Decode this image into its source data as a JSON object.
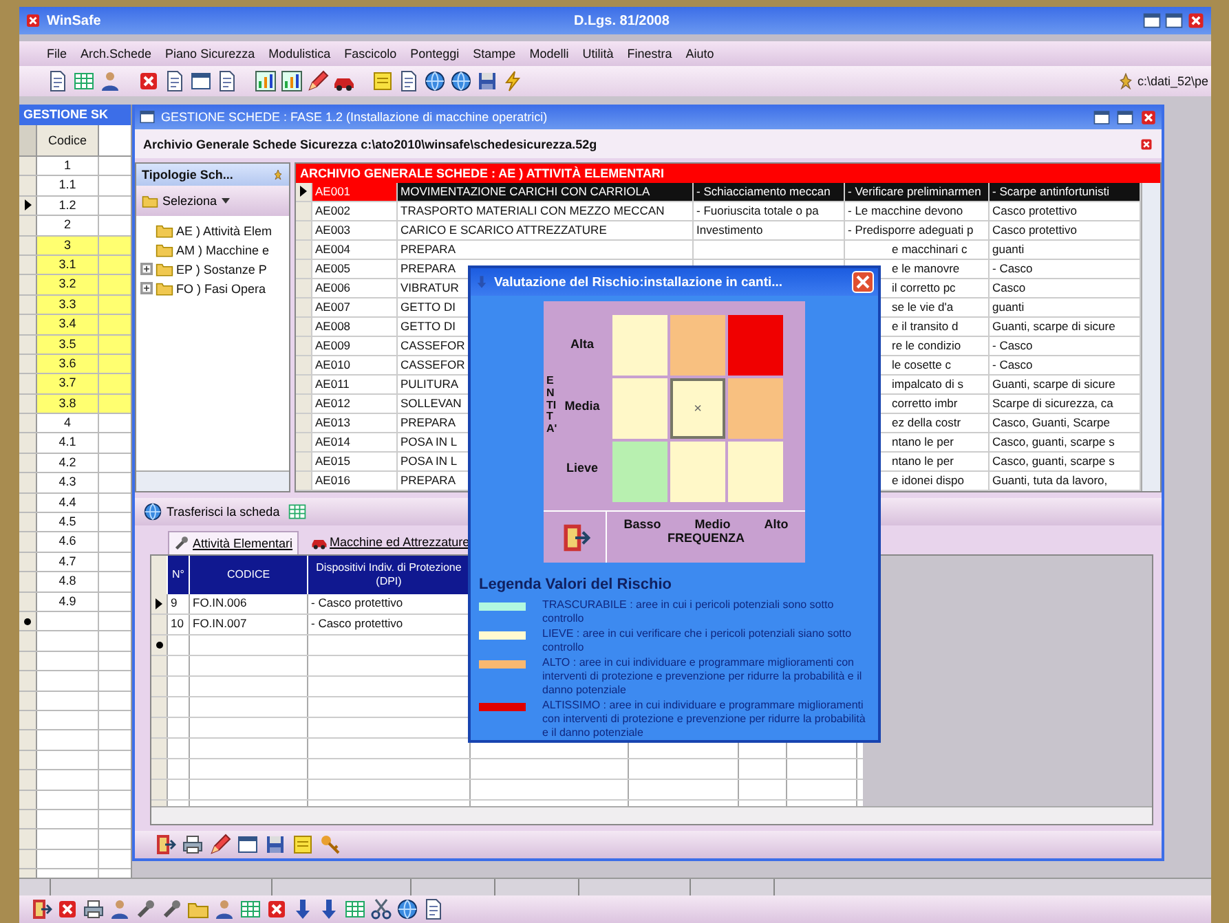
{
  "app": {
    "title": "WinSafe",
    "subtitle": "D.Lgs. 81/2008",
    "path": "c:\\dati_52\\pe"
  },
  "menu": [
    "File",
    "Arch.Schede",
    "Piano Sicurezza",
    "Modulistica",
    "Fascicolo",
    "Ponteggi",
    "Stampe",
    "Modelli",
    "Utilità",
    "Finestra",
    "Aiuto"
  ],
  "side_panel": {
    "title": "GESTIONE SK",
    "column": "Codice",
    "rows": [
      {
        "code": "1",
        "highlighted": false,
        "selected": false
      },
      {
        "code": "1.1",
        "highlighted": false,
        "selected": false
      },
      {
        "code": "1.2",
        "highlighted": false,
        "selected": true
      },
      {
        "code": "2",
        "highlighted": false,
        "selected": false
      },
      {
        "code": "3",
        "highlighted": true,
        "selected": false
      },
      {
        "code": "3.1",
        "highlighted": true,
        "selected": false
      },
      {
        "code": "3.2",
        "highlighted": true,
        "selected": false
      },
      {
        "code": "3.3",
        "highlighted": true,
        "selected": false
      },
      {
        "code": "3.4",
        "highlighted": true,
        "selected": false
      },
      {
        "code": "3.5",
        "highlighted": true,
        "selected": false
      },
      {
        "code": "3.6",
        "highlighted": true,
        "selected": false
      },
      {
        "code": "3.7",
        "highlighted": true,
        "selected": false
      },
      {
        "code": "3.8",
        "highlighted": true,
        "selected": false
      },
      {
        "code": "4",
        "highlighted": false,
        "selected": false
      },
      {
        "code": "4.1",
        "highlighted": false,
        "selected": false
      },
      {
        "code": "4.2",
        "highlighted": false,
        "selected": false
      },
      {
        "code": "4.3",
        "highlighted": false,
        "selected": false
      },
      {
        "code": "4.4",
        "highlighted": false,
        "selected": false
      },
      {
        "code": "4.5",
        "highlighted": false,
        "selected": false
      },
      {
        "code": "4.6",
        "highlighted": false,
        "selected": false
      },
      {
        "code": "4.7",
        "highlighted": false,
        "selected": false
      },
      {
        "code": "4.8",
        "highlighted": false,
        "selected": false
      },
      {
        "code": "4.9",
        "highlighted": false,
        "selected": false
      }
    ]
  },
  "child_window": {
    "title": "GESTIONE SCHEDE : FASE 1.2 (Installazione di macchine operatrici)",
    "header": "Archivio Generale Schede Sicurezza c:\\ato2010\\winsafe\\schedesicurezza.52g",
    "tree_panel": {
      "title": "Tipologie Sch...",
      "button": "Seleziona",
      "items": [
        {
          "label": "AE ) Attività Elem",
          "expandable": false
        },
        {
          "label": "AM ) Macchine e",
          "expandable": false
        },
        {
          "label": "EP ) Sostanze P",
          "expandable": true
        },
        {
          "label": "FO ) Fasi Opera",
          "expandable": true
        }
      ]
    },
    "table": {
      "title": "ARCHIVIO GENERALE SCHEDE : AE ) ATTIVITÀ ELEMENTARI",
      "rows": [
        {
          "code": "AE001",
          "column_2": "MOVIMENTAZIONE CARICHI CON CARRIOLA",
          "column_3": "- Schiacciamento meccan",
          "column_4": "- Verificare preliminarmen",
          "column_5": "- Scarpe antinfortunisti",
          "selected": true
        },
        {
          "code": "AE002",
          "column_2": "TRASPORTO MATERIALI CON MEZZO MECCAN",
          "column_3": "- Fuoriuscita totale o pa",
          "column_4": "- Le macchine devono",
          "column_5": "Casco protettivo",
          "selected": false
        },
        {
          "code": "AE003",
          "column_2": "CARICO E SCARICO ATTREZZATURE",
          "column_3": "Investimento",
          "column_4": "- Predisporre adeguati p",
          "column_5": "Casco protettivo",
          "selected": false
        },
        {
          "code": "AE004",
          "column_2": "PREPARA",
          "column_4": "e macchinari c",
          "column_5": "guanti",
          "selected": false
        },
        {
          "code": "AE005",
          "column_2": "PREPARA",
          "column_4": "e le manovre",
          "column_5": "- Casco",
          "selected": false
        },
        {
          "code": "AE006",
          "column_2": "VIBRATUR",
          "column_4": "il corretto pc",
          "column_5": "Casco",
          "selected": false
        },
        {
          "code": "AE007",
          "column_2": "GETTO DI",
          "column_4": "se le vie d'a",
          "column_5": "guanti",
          "selected": false
        },
        {
          "code": "AE008",
          "column_2": "GETTO DI",
          "column_4": "e il transito d",
          "column_5": "Guanti, scarpe di sicure",
          "selected": false
        },
        {
          "code": "AE009",
          "column_2": "CASSEFOR",
          "column_4": "re le condizio",
          "column_5": "- Casco",
          "selected": false
        },
        {
          "code": "AE010",
          "column_2": "CASSEFOR",
          "column_4": "le cosette c",
          "column_5": "- Casco",
          "selected": false
        },
        {
          "code": "AE011",
          "column_2": "PULITURA",
          "column_4": "impalcato di s",
          "column_5": "Guanti, scarpe di sicure",
          "selected": false
        },
        {
          "code": "AE012",
          "column_2": "SOLLEVAN",
          "column_4": "corretto imbr",
          "column_5": "Scarpe di sicurezza, ca",
          "selected": false
        },
        {
          "code": "AE013",
          "column_2": "PREPARA",
          "column_4": "ez della costr",
          "column_5": "Casco, Guanti, Scarpe",
          "selected": false
        },
        {
          "code": "AE014",
          "column_2": "POSA IN L",
          "column_4": "ntano le per",
          "column_5": "Casco, guanti, scarpe s",
          "selected": false
        },
        {
          "code": "AE015",
          "column_2": "POSA IN L",
          "column_4": "ntano le per",
          "column_5": "Casco, guanti, scarpe s",
          "selected": false
        },
        {
          "code": "AE016",
          "column_2": "PREPARA",
          "column_4": "e idonei dispo",
          "column_5": "Guanti, tuta da lavoro,",
          "selected": false
        }
      ]
    },
    "transfer_button": "Trasferisci la scheda",
    "tabs": [
      {
        "label": "Attività Elementari",
        "selected": true
      },
      {
        "label": "Macchine ed Attrezzature",
        "selected": false
      }
    ],
    "lower_table": {
      "columns": [
        "N°",
        "CODICE",
        "Dispositivi Indiv. di Protezione (DPI)"
      ],
      "rows": [
        {
          "number": "9",
          "code": "FO.IN.006",
          "dpi": "- Casco protettivo",
          "selected": true
        },
        {
          "number": "10",
          "code": "FO.IN.007",
          "dpi": "- Casco protettivo",
          "selected": false
        }
      ]
    }
  },
  "dialog": {
    "title": "Valutazione del Rischio:installazione in canti...",
    "y_axis": "ENTITA'",
    "marker": "×",
    "rows": [
      {
        "label": "Alta",
        "cells": [
          {
            "color": "#fff8c8",
            "marked": false
          },
          {
            "color": "#f8c080",
            "marked": false
          },
          {
            "color": "#f00000",
            "marked": false
          }
        ]
      },
      {
        "label": "Media",
        "cells": [
          {
            "color": "#fff8c8",
            "marked": false
          },
          {
            "color": "#fff8c8",
            "marked": true
          },
          {
            "color": "#f8c080",
            "marked": false
          }
        ]
      },
      {
        "label": "Lieve",
        "cells": [
          {
            "color": "#b8f0b0",
            "marked": false
          },
          {
            "color": "#fff8c8",
            "marked": false
          },
          {
            "color": "#fff8c8",
            "marked": false
          }
        ]
      }
    ],
    "x_labels": [
      "Basso",
      "Medio",
      "Alto"
    ],
    "x_axis": "FREQUENZA",
    "legend_title": "Legenda Valori del Rischio",
    "legend": [
      {
        "color": "#b0f8e0",
        "text": "TRASCURABILE : aree in cui i pericoli potenziali sono sotto controllo"
      },
      {
        "color": "#fffad0",
        "text": "LIEVE : aree in cui verificare che i pericoli potenziali siano sotto controllo"
      },
      {
        "color": "#f8b870",
        "text": "ALTO : aree in cui individuare e programmare miglioramenti con interventi di protezione e prevenzione per ridurre la probabilità e il danno potenziale"
      },
      {
        "color": "#e00000",
        "text": "ALTISSIMO : aree in cui individuare e programmare miglioramenti con interventi di protezione e prevenzione per ridurre la probabilità e il danno potenziale"
      }
    ]
  }
}
